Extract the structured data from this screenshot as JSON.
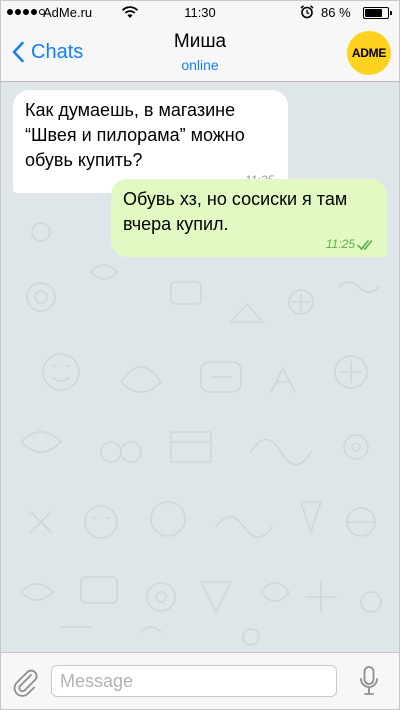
{
  "status_bar": {
    "carrier": "AdMe.ru",
    "time": "11:30",
    "battery_percent": "86 %",
    "battery_level": 0.86,
    "icons": [
      "signal-dots",
      "wifi-icon",
      "alarm-icon",
      "battery-icon"
    ]
  },
  "nav": {
    "back_label": "Chats",
    "title": "Миша",
    "status": "online",
    "avatar_text": "ADME"
  },
  "messages": [
    {
      "direction": "incoming",
      "text": "Как думаешь, в магазине\n“Швея и пилорама” можно\nобувь купить?",
      "time": "11:25"
    },
    {
      "direction": "outgoing",
      "text": "Обувь хз, но сосиски я там\nвчера купил.",
      "time": "11:25",
      "read": true
    }
  ],
  "composer": {
    "placeholder": "Message",
    "value": ""
  },
  "colors": {
    "accent": "#147efb",
    "chat_background": "#dfe6e9",
    "outgoing_bubble": "#e2f9c3",
    "incoming_bubble": "#ffffff",
    "avatar": "#ffd21f"
  }
}
